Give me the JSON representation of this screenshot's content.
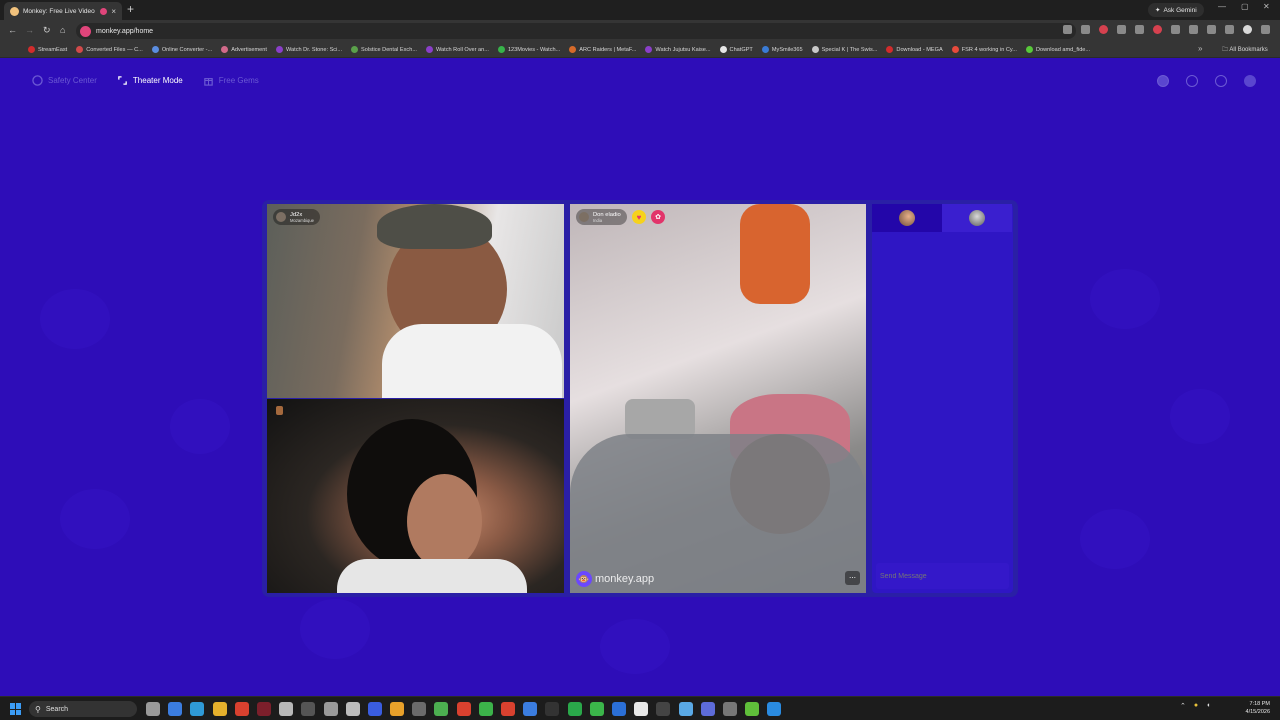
{
  "browser": {
    "tab_title": "Monkey: Free Live Video Ch",
    "new_tab_symbol": "+",
    "close_symbol": "×",
    "url": "monkey.app/home",
    "ask_gemini": "Ask Gemini",
    "all_bookmarks": "All Bookmarks",
    "bookmarks": [
      {
        "label": "StreamEast",
        "color": "#d12c2c"
      },
      {
        "label": "Converted Files — C...",
        "color": "#d14a4a"
      },
      {
        "label": "Online Converter -...",
        "color": "#5b8de0"
      },
      {
        "label": "Advertisement",
        "color": "#d16a8a"
      },
      {
        "label": "Watch Dr. Stone: Sci...",
        "color": "#8a3fc9"
      },
      {
        "label": "Solstice Dental Exch...",
        "color": "#5aa04a"
      },
      {
        "label": "Watch Roll Over an...",
        "color": "#8a3fc9"
      },
      {
        "label": "123Movies - Watch...",
        "color": "#37b34a"
      },
      {
        "label": "ARC Raiders | MetaF...",
        "color": "#d66a2a"
      },
      {
        "label": "Watch Jujutsu Kaise...",
        "color": "#8a3fc9"
      },
      {
        "label": "ChatGPT",
        "color": "#e6e6e6"
      },
      {
        "label": "MySmile365",
        "color": "#3a7bd5"
      },
      {
        "label": "Special K | The Swis...",
        "color": "#c9c9c9"
      },
      {
        "label": "Download - MEGA",
        "color": "#d12c2c"
      },
      {
        "label": "FSR 4 working in Cy...",
        "color": "#e64a3c"
      },
      {
        "label": "Download amd_fide...",
        "color": "#58c93a"
      }
    ]
  },
  "app": {
    "nav": {
      "safety_center": "Safety Center",
      "theater_mode": "Theater Mode",
      "free_gems": "Free Gems"
    },
    "videos": {
      "top_left": {
        "name": "Jd2x",
        "country": "Mozambique"
      },
      "right": {
        "name": "Don eladio",
        "country": "India"
      },
      "watermark": "monkey.app"
    },
    "chat": {
      "placeholder": "Send Message"
    }
  },
  "taskbar": {
    "search_label": "Search",
    "time": "7:18 PM",
    "date": "4/15/2026"
  }
}
